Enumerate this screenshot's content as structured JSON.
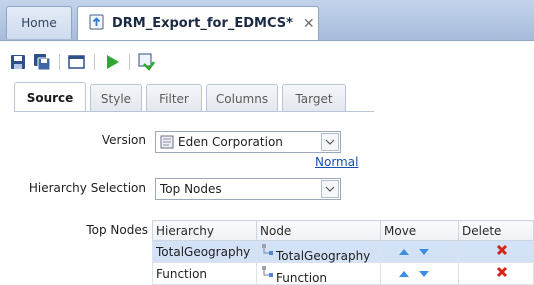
{
  "tabs": {
    "home_label": "Home",
    "active_label": "DRM_Export_for_EDMCS*"
  },
  "subtabs": [
    "Source",
    "Style",
    "Filter",
    "Columns",
    "Target"
  ],
  "form": {
    "version_label": "Version",
    "version_value": "Eden Corporation",
    "normal_link": "Normal",
    "hierarchy_selection_label": "Hierarchy Selection",
    "hierarchy_selection_value": "Top Nodes",
    "top_nodes_label": "Top Nodes"
  },
  "table": {
    "headers": [
      "Hierarchy",
      "Node",
      "Move",
      "Delete"
    ],
    "rows": [
      {
        "hierarchy": "TotalGeography",
        "node": "TotalGeography"
      },
      {
        "hierarchy": "Function",
        "node": "Function"
      }
    ]
  },
  "colors": {
    "accent_blue": "#1a4fb0",
    "delete_red": "#d3261b",
    "run_green": "#2ea82e",
    "selected_row": "#d3e2f6"
  }
}
